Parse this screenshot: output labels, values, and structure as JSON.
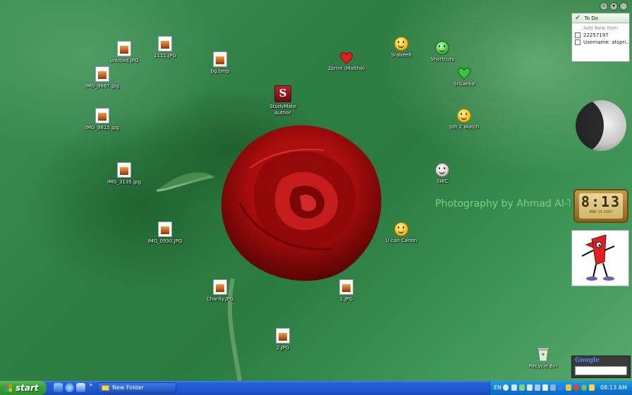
{
  "desktop": {
    "icons": [
      {
        "label": "untitled.JPG",
        "name": "icon-untitled-jpg",
        "kind": "file"
      },
      {
        "label": "1111.JPG",
        "name": "icon-1111-jpg",
        "kind": "file"
      },
      {
        "label": "IMG_9867.jpg",
        "name": "icon-img-9867",
        "kind": "file"
      },
      {
        "label": "IMG_9815.jpg",
        "name": "icon-img-9815",
        "kind": "file"
      },
      {
        "label": "IMG_3135.jpg",
        "name": "icon-img-3135",
        "kind": "file"
      },
      {
        "label": "IMG_0930.JPG",
        "name": "icon-img-0930",
        "kind": "file"
      },
      {
        "label": "bg.bmp",
        "name": "icon-bg-bmp",
        "kind": "bmp"
      },
      {
        "label": "StudyMate Author",
        "name": "icon-studymate-author",
        "kind": "app"
      },
      {
        "label": "2print (Maltha)",
        "name": "icon-2print-maltha",
        "kind": "heart"
      },
      {
        "label": "Srabee6",
        "name": "icon-srabee6",
        "kind": "smile"
      },
      {
        "label": "Shortcuts",
        "name": "icon-shortcuts",
        "kind": "green"
      },
      {
        "label": "SriLanka",
        "name": "icon-srilanka",
        "kind": "greenheart"
      },
      {
        "label": "Sth 2 Watch",
        "name": "icon-sth-2-watch",
        "kind": "smile"
      },
      {
        "label": "SWC",
        "name": "icon-swc",
        "kind": "grey"
      },
      {
        "label": "U can Canon",
        "name": "icon-u-can-canon",
        "kind": "smile"
      },
      {
        "label": "Charity.JPG",
        "name": "icon-charity-jpg",
        "kind": "file"
      },
      {
        "label": "1.JPG",
        "name": "icon-1-jpg",
        "kind": "file"
      },
      {
        "label": "2.JPG",
        "name": "icon-2-jpg",
        "kind": "file"
      },
      {
        "label": "Recycle Bin",
        "name": "icon-recycle-bin",
        "kind": "bin"
      }
    ],
    "watermark": "Photography by Ahmad Al-T",
    "studymate_letter": "S"
  },
  "gadgets": {
    "todo": {
      "title": "To Do",
      "add_placeholder": "Add New Item",
      "items": [
        "22257197",
        "Username: atspri..."
      ]
    },
    "clock": {
      "time": "8:13",
      "date": "MAY 15 2007"
    },
    "google": {
      "logo": "Google"
    }
  },
  "taskbar": {
    "start_label": "start",
    "overflow_label": "»",
    "task_label": "New Folder",
    "language": "EN",
    "clock": "08:13 AM"
  },
  "colors": {
    "accent": "#2258d0",
    "start_green": "#38a238",
    "tray_blue": "#0e7ad0"
  }
}
